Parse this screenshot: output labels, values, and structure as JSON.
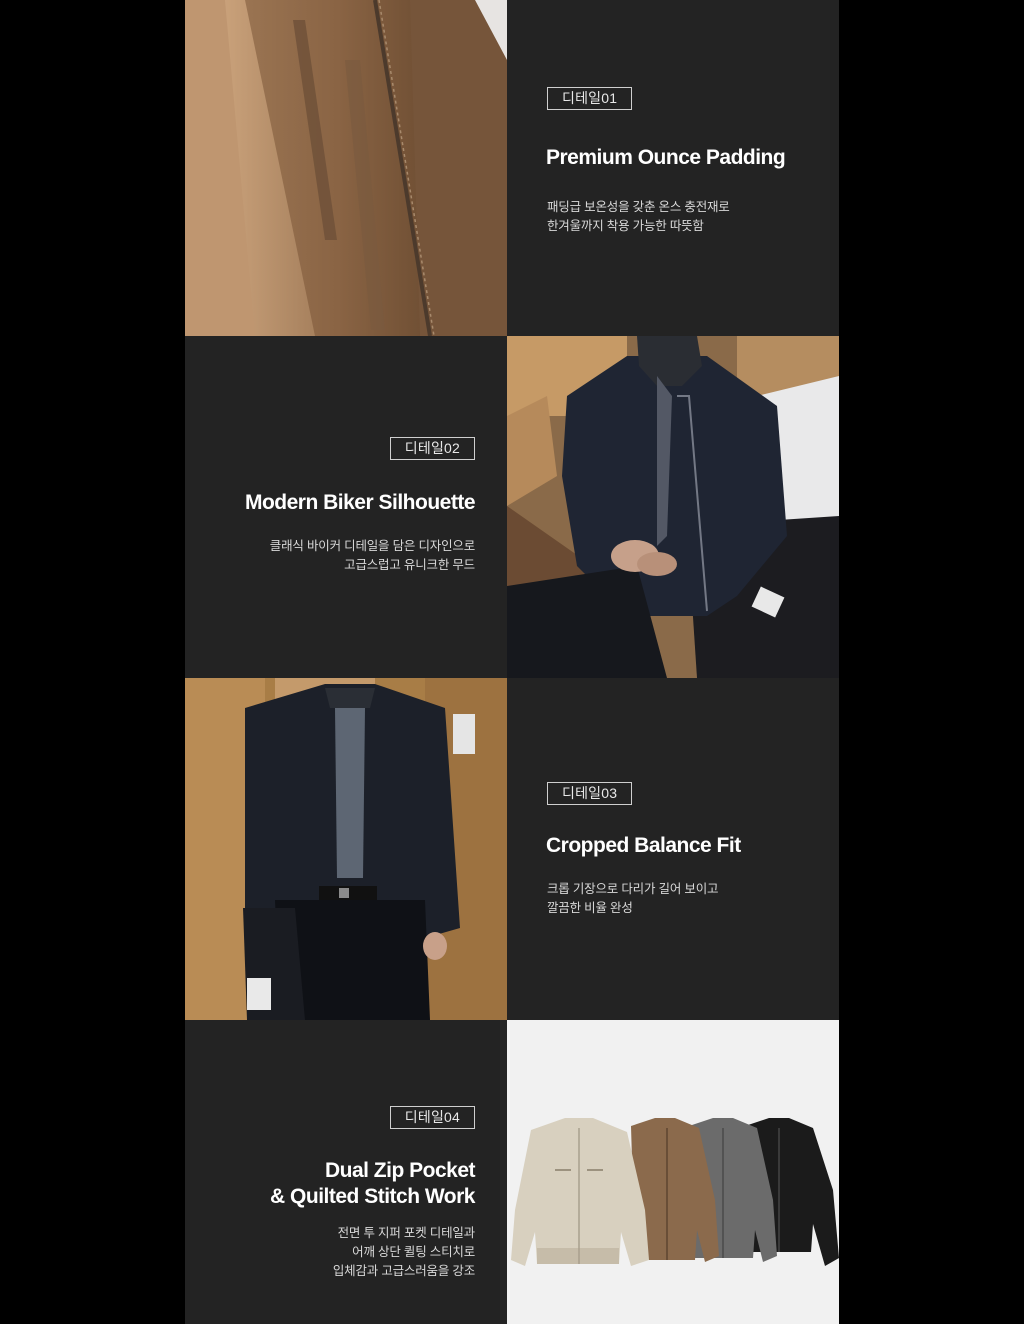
{
  "details": [
    {
      "badge": "디테일01",
      "title_lines": [
        "Premium Ounce Padding"
      ],
      "desc_lines": [
        "패딩급 보온성을 갖춘 온스 충전재로",
        "한겨울까지 착용 가능한 따뜻함"
      ]
    },
    {
      "badge": "디테일02",
      "title_lines": [
        "Modern Biker Silhouette"
      ],
      "desc_lines": [
        "클래식 바이커 디테일을 담은 디자인으로",
        "고급스럽고 유니크한 무드"
      ]
    },
    {
      "badge": "디테일03",
      "title_lines": [
        "Cropped Balance Fit"
      ],
      "desc_lines": [
        "크롭 기장으로 다리가 길어 보이고",
        "깔끔한 비율 완성"
      ]
    },
    {
      "badge": "디테일04",
      "title_lines": [
        "Dual Zip Pocket",
        "& Quilted Stitch Work"
      ],
      "desc_lines": [
        "전면 투 지퍼 포켓 디테일과",
        "어깨 상단 퀼팅 스티치로",
        "입체감과 고급스러움을 강조"
      ]
    }
  ],
  "colors": {
    "panel": "#232323",
    "page_bg": "#000000",
    "jacket_brown": "#8b6a4c",
    "jacket_navy": "#1f2530",
    "jacket_beige": "#d8d0bf",
    "jacket_grey": "#6b6b6b",
    "jacket_black": "#1b1b1b"
  },
  "images": {
    "brown_closeup": "brown-jacket-closeup",
    "navy_seated": "navy-jacket-seated",
    "navy_standing": "navy-jacket-standing",
    "four_colors": "jacket-four-colorways"
  }
}
